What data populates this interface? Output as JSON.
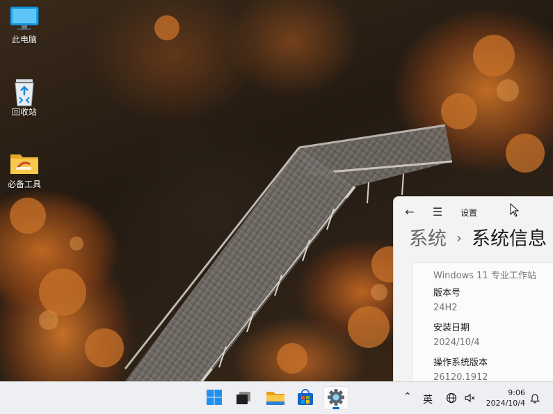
{
  "desktop": {
    "icons": [
      {
        "label": "此电脑",
        "icon": "this-pc-icon"
      },
      {
        "label": "回收站",
        "icon": "recycle-bin-icon"
      },
      {
        "label": "必备工具",
        "icon": "folder-icon"
      }
    ]
  },
  "settings": {
    "title": "设置",
    "breadcrumb_parent": "系统",
    "breadcrumb_separator": "›",
    "breadcrumb_current": "系统信息",
    "edition_value": "Windows 11 专业工作站",
    "version_label": "版本号",
    "version_value": "24H2",
    "install_date_label": "安装日期",
    "install_date_value": "2024/10/4",
    "os_build_label": "操作系统版本",
    "os_build_value": "26120.1912"
  },
  "taskbar": {
    "apps": [
      {
        "name": "start",
        "icon": "windows-logo-icon"
      },
      {
        "name": "task-view",
        "icon": "task-view-icon"
      },
      {
        "name": "file-explorer",
        "icon": "file-explorer-icon"
      },
      {
        "name": "microsoft-store",
        "icon": "store-icon"
      },
      {
        "name": "settings",
        "icon": "gear-icon",
        "active": true
      }
    ],
    "tray": {
      "ime_label": "英",
      "time": "9:06",
      "date": "2024/10/4"
    }
  },
  "colors": {
    "accent": "#0067c0",
    "settings_bg": "#f3f3f3",
    "taskbar_bg": "#eeeff2"
  }
}
